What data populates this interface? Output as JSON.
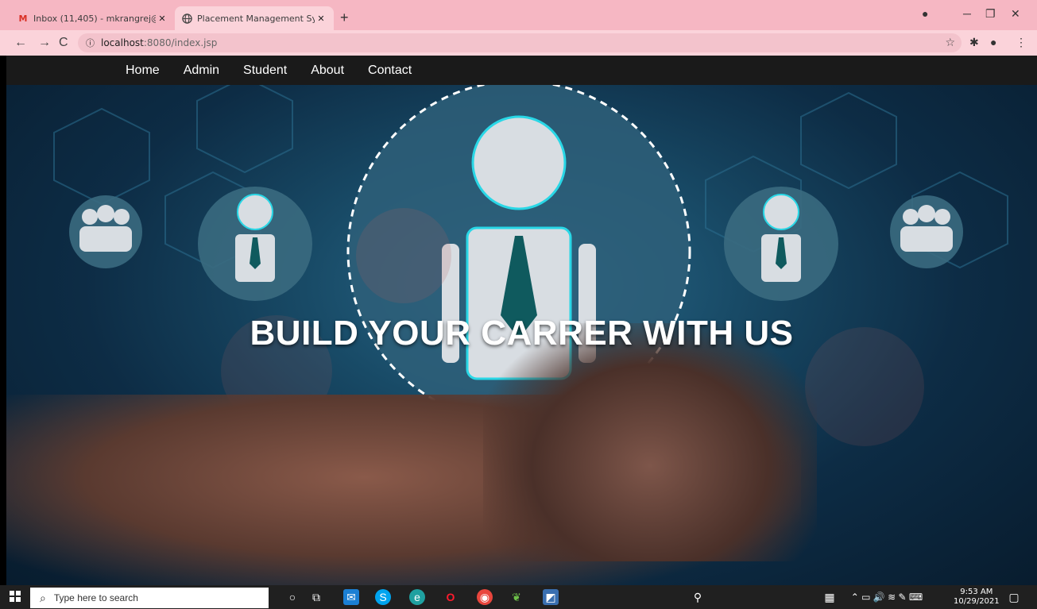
{
  "browser": {
    "tabs": [
      {
        "title": "Inbox (11,405) - mkrangrej@gma...",
        "icon": "gmail-icon",
        "active": false
      },
      {
        "title": "Placement Management System",
        "icon": "globe-icon",
        "active": true
      }
    ],
    "url_host": "localhost",
    "url_path": ":8080/index.jsp"
  },
  "nav": {
    "items": [
      "Home",
      "Admin",
      "Student",
      "About",
      "Contact"
    ]
  },
  "hero": {
    "title": "BUILD YOUR CARRER WITH US"
  },
  "taskbar": {
    "search_placeholder": "Type here to search",
    "time": "9:53 AM",
    "date": "10/29/2021"
  },
  "colors": {
    "tabstrip": "#f6b7c3",
    "toolbar": "#fbd3da",
    "nav_bg": "#1a1a1a",
    "taskbar": "#202020"
  }
}
